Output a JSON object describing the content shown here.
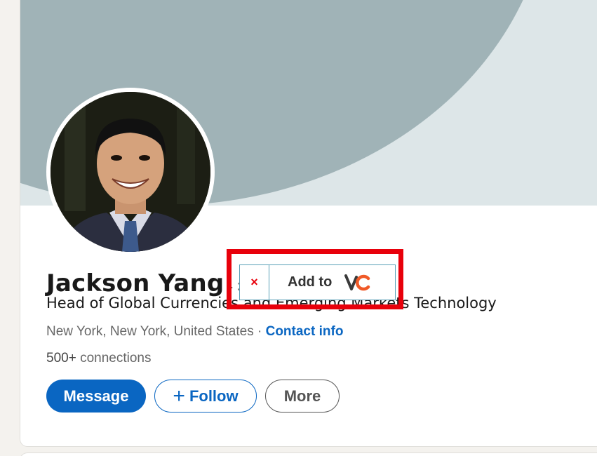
{
  "profile": {
    "name": "Jackson Yang",
    "degree": "· 3rd",
    "headline": "Head of Global Currencies and Emerging Markets Technology",
    "location": "New York, New York, United States",
    "separator": " · ",
    "contact_info": "Contact info",
    "connections_count": "500+",
    "connections_label": " connections"
  },
  "actions": {
    "message": "Message",
    "follow": "Follow",
    "follow_icon": "+",
    "more": "More"
  },
  "extension": {
    "close_icon": "×",
    "label": "Add to",
    "logo": "vc-logo-icon",
    "highlight_color": "#e8000b",
    "border_color": "#5aa0b8"
  },
  "colors": {
    "brand": "#0a66c2",
    "banner": "#a0b3b7",
    "banner_bg": "#dde6e8"
  }
}
